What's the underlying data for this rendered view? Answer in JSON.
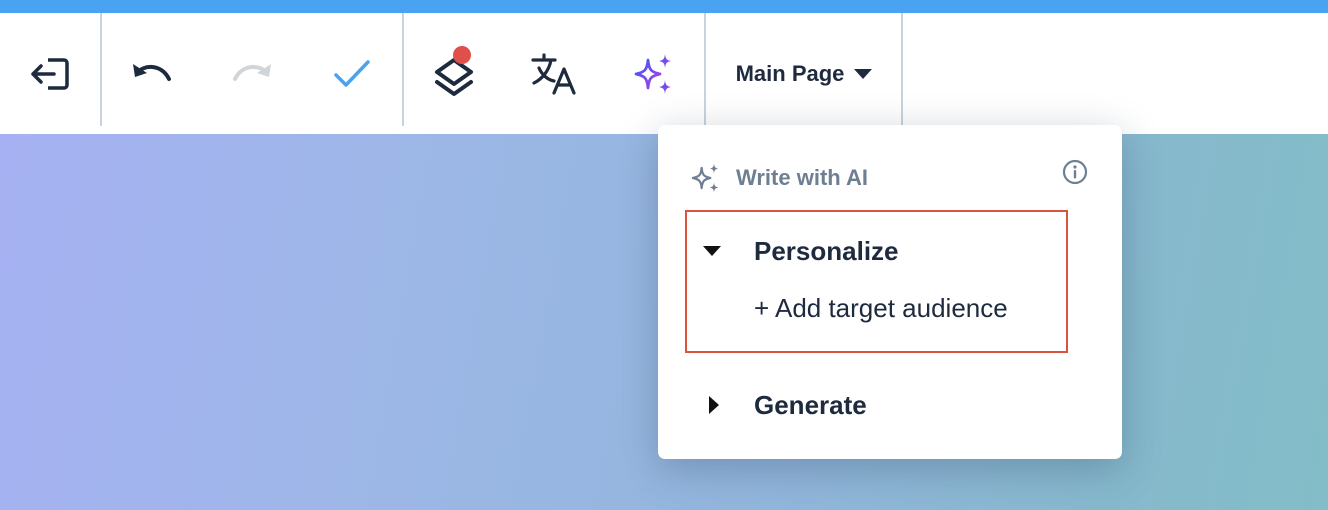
{
  "toolbar": {
    "page_selector_label": "Main Page",
    "icons": [
      "exit-icon",
      "undo-icon",
      "redo-icon",
      "checkmark-icon",
      "layers-icon",
      "translate-icon",
      "ai-sparkle-icon",
      "caret-down-icon"
    ],
    "colors": {
      "accent": "#4aa3f2",
      "dark": "#1e2a3e",
      "disabled": "#d0d5da",
      "check": "#4aa3f2",
      "notification": "#e0504a",
      "ai": "#7b3ff2"
    }
  },
  "ai_menu": {
    "header_label": "Write with AI",
    "sections": [
      {
        "label": "Personalize",
        "expanded": true,
        "items": [
          "+ Add target audience"
        ]
      },
      {
        "label": "Generate",
        "expanded": false,
        "items": []
      }
    ],
    "highlight_color": "#d9533e"
  }
}
